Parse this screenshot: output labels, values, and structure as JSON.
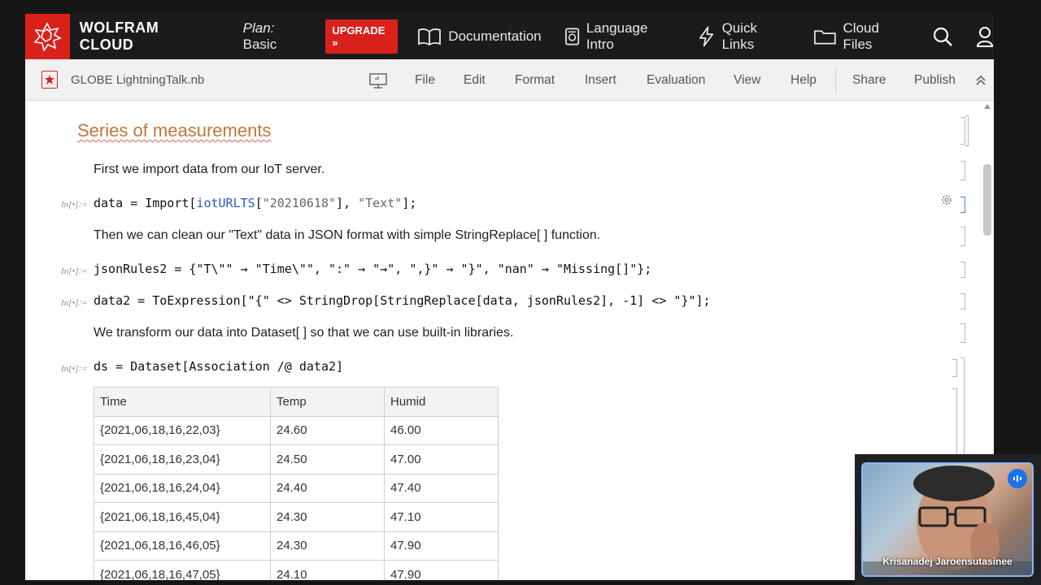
{
  "topbar": {
    "brand": "WOLFRAM CLOUD",
    "plan_label": "Plan:",
    "plan_value": "Basic",
    "upgrade": "UPGRADE »",
    "nav": [
      "Documentation",
      "Language Intro",
      "Quick Links",
      "Cloud Files"
    ],
    "icons": [
      "search-icon",
      "user-icon"
    ]
  },
  "notebook_bar": {
    "title": "GLOBE LightningTalk.nb",
    "menu": [
      "File",
      "Edit",
      "Format",
      "Insert",
      "Evaluation",
      "View",
      "Help",
      "Share",
      "Publish"
    ]
  },
  "notebook": {
    "section_title": "Series of measurements",
    "input_label": "In[•]:=",
    "text1": "First we import data from our IoT server.",
    "code1": {
      "a": "data = Import[",
      "fn": "iotURLTS",
      "b": "[",
      "s1": "\"20210618\"",
      "c": "], ",
      "s2": "\"Text\"",
      "d": "];"
    },
    "text2": "Then we can clean our \"Text\" data in JSON format with simple StringReplace[ ] function.",
    "code2": "jsonRules2 = {\"T\\\"\" → \"Time\\\"\", \":\" → \"→\", \",}\" → \"}\", \"nan\" → \"Missing[]\"};",
    "code3": "data2 = ToExpression[\"{\" <> StringDrop[StringReplace[data, jsonRules2], -1] <> \"}\"];",
    "text3": "We transform our data into Dataset[ ] so that we can use built-in libraries.",
    "code4": "ds = Dataset[Association /@ data2]"
  },
  "dataset": {
    "headers": [
      "Time",
      "Temp",
      "Humid"
    ],
    "rows": [
      [
        "{2021,06,18,16,22,03}",
        "24.60",
        "46.00"
      ],
      [
        "{2021,06,18,16,23,04}",
        "24.50",
        "47.00"
      ],
      [
        "{2021,06,18,16,24,04}",
        "24.40",
        "47.40"
      ],
      [
        "{2021,06,18,16,45,04}",
        "24.30",
        "47.10"
      ],
      [
        "{2021,06,18,16,46,05}",
        "24.30",
        "47.90"
      ],
      [
        "{2021,06,18,16,47,05}",
        "24.10",
        "47.90"
      ]
    ]
  },
  "video": {
    "speaker": "Krisanadej Jaroensutasinee"
  },
  "colors": {
    "wolfram_red": "#d9211b",
    "section_orange": "#c0773a",
    "active_blue": "#4a86d6"
  }
}
